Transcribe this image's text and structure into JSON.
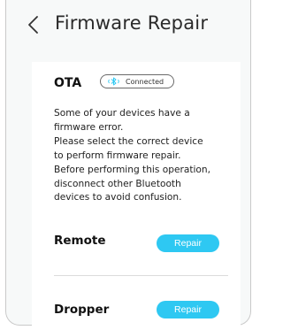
{
  "header": {
    "title": "Firmware Repair"
  },
  "ota": {
    "label": "OTA",
    "status": "Connected",
    "status_icon": "bluetooth-icon"
  },
  "message": {
    "lines": [
      "Some of your devices have a",
      "firmware error.",
      "Please select the correct device",
      "to perform firmware repair.",
      "Before performing this operation,",
      "disconnect other Bluetooth",
      "devices to avoid confusion."
    ]
  },
  "devices": [
    {
      "name": "Remote",
      "action": "Repair"
    },
    {
      "name": "Dropper",
      "action": "Repair"
    }
  ],
  "colors": {
    "accent": "#2ec8f2",
    "background": "#f7f9f9",
    "card": "#ffffff"
  }
}
